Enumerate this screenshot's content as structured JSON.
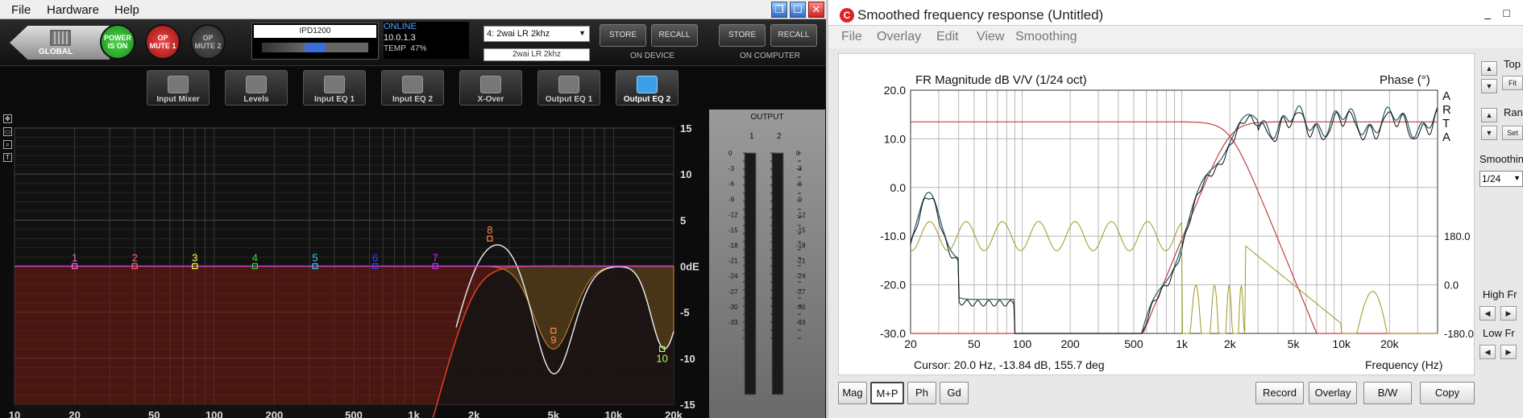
{
  "left_app": {
    "menu": [
      "File",
      "Hardware",
      "Help"
    ],
    "window_buttons": [
      "restore",
      "maximize",
      "close"
    ],
    "global_label": "GLOBAL",
    "power_button": "POWER IS ON",
    "op_mute_1": "OP MUTE 1",
    "op_mute_2": "OP MUTE 2",
    "device_name": "IPD1200",
    "online_status": "ONLINE",
    "ip_address": "10.0.1.3",
    "temp_label": "TEMP",
    "temp_value": "47%",
    "preset_select": "4: 2wai LR 2khz",
    "preset_name": "2wai LR 2khz",
    "store_label": "STORE",
    "recall_label": "RECALL",
    "on_device_label": "ON DEVICE",
    "on_computer_label": "ON COMPUTER",
    "tabs": [
      "Input Mixer",
      "Levels",
      "Input EQ 1",
      "Input EQ 2",
      "X-Over",
      "Output EQ 1",
      "Output EQ 2"
    ],
    "active_tab": "Output EQ 2",
    "eq_plot": {
      "x_ticks": [
        "10",
        "20",
        "50",
        "100",
        "200",
        "500",
        "1k",
        "2k",
        "5k",
        "10k",
        "20k"
      ],
      "y_ticks_right": [
        "15",
        "10",
        "5",
        "0dE",
        "-5",
        "-10",
        "-15"
      ],
      "band_markers": [
        "1",
        "2",
        "3",
        "4",
        "5",
        "6",
        "7",
        "8",
        "9",
        "10"
      ],
      "band_colors": [
        "#ff66cc",
        "#ff6666",
        "#ffff33",
        "#33dd33",
        "#33ccff",
        "#3344ff",
        "#cc33ff",
        "#ff8844",
        "#ff8844",
        "#aaff66"
      ]
    },
    "output": {
      "title": "OUTPUT",
      "channels": [
        "1",
        "2"
      ],
      "meter_ticks": [
        "0",
        "-3",
        "-6",
        "-9",
        "-12",
        "-15",
        "-18",
        "-21",
        "-24",
        "-27",
        "-30",
        "-33"
      ]
    }
  },
  "right_app": {
    "title": "Smoothed frequency response (Untitled)",
    "menu": [
      "File",
      "Overlay",
      "Edit",
      "View",
      "Smoothing"
    ],
    "plot_title": "FR Magnitude dB V/V (1/24 oct)",
    "phase_label": "Phase (°)",
    "brand_vertical": [
      "A",
      "R",
      "T",
      "A"
    ],
    "y_ticks": [
      "20.0",
      "10.0",
      "0.0",
      "-10.0",
      "-20.0",
      "-30.0"
    ],
    "phase_ticks": [
      "180.0",
      "0.0",
      "-180.0"
    ],
    "x_ticks": [
      "20",
      "50",
      "100",
      "200",
      "500",
      "1k",
      "2k",
      "5k",
      "10k",
      "20k"
    ],
    "cursor_text": "Cursor: 20.0 Hz, -13.84 dB, 155.7 deg",
    "x_axis_label": "Frequency (Hz)",
    "bottom_buttons": [
      "Mag",
      "M+P",
      "Ph",
      "Gd"
    ],
    "selected_bottom": "M+P",
    "action_buttons": [
      "Record",
      "Overlay",
      "B/W",
      "Copy"
    ],
    "side": {
      "top_label": "Top",
      "fit_label": "Fit",
      "range_label": "Rang",
      "set_label": "Set",
      "smoothing_label": "Smoothing",
      "smoothing_value": "1/24",
      "high_fr_label": "High Fr",
      "low_fr_label": "Low Fr"
    },
    "colors": {
      "magnitude": "#205a6a",
      "reference": "#111111",
      "phase": "#9a9a20",
      "crossover": "#c04040"
    }
  }
}
